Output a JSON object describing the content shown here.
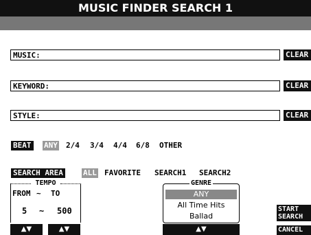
{
  "title": "MUSIC FINDER SEARCH 1",
  "fields": [
    {
      "label": "MUSIC:",
      "value": "",
      "clear": "CLEAR"
    },
    {
      "label": "KEYWORD:",
      "value": "",
      "clear": "CLEAR"
    },
    {
      "label": "STYLE:",
      "value": "",
      "clear": "CLEAR"
    }
  ],
  "beat": {
    "label": "BEAT",
    "options": [
      "ANY",
      "2/4",
      "3/4",
      "4/4",
      "6/8",
      "OTHER"
    ],
    "selected": "ANY"
  },
  "search_area": {
    "label": "SEARCH AREA",
    "options": [
      "ALL",
      "FAVORITE",
      "SEARCH1",
      "SEARCH2"
    ],
    "selected": "ALL"
  },
  "tempo": {
    "title": "TEMPO",
    "from_label": "FROM",
    "tilde": "~",
    "to_label": "TO",
    "from_value": "5",
    "to_value": "500",
    "arrows": "▲▼"
  },
  "genre": {
    "title": "GENRE",
    "items": [
      "ANY",
      "All Time Hits",
      "Ballad"
    ],
    "selected": "ANY",
    "arrows": "▲▼"
  },
  "buttons": {
    "start_search": [
      "START",
      "SEARCH"
    ],
    "cancel": "CANCEL"
  }
}
